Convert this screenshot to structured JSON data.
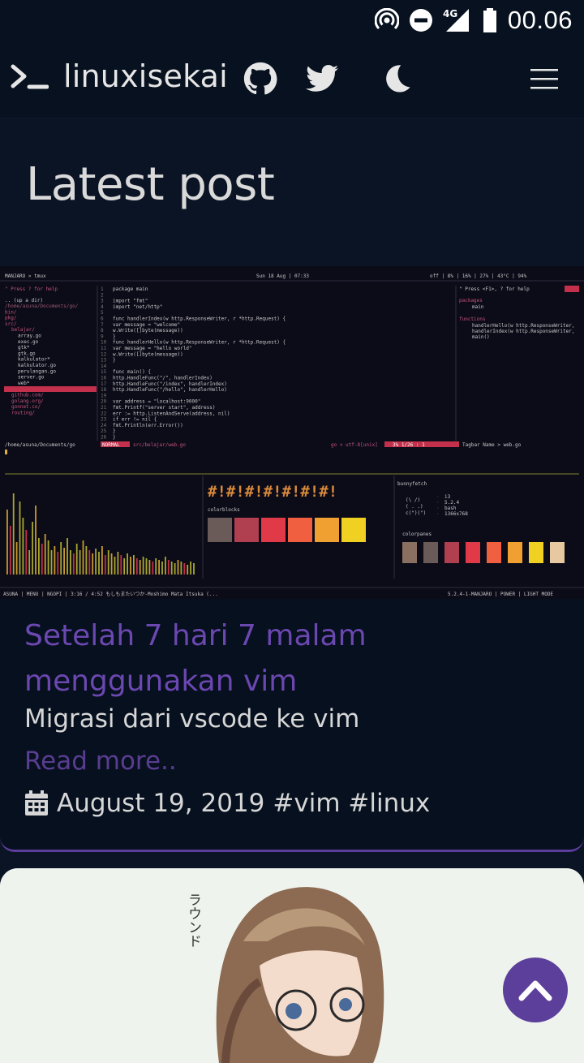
{
  "status_bar": {
    "time": "00.06",
    "network_label": "4G",
    "icons": [
      "hotspot-icon",
      "do-not-disturb-icon",
      "signal-4g-icon",
      "battery-icon"
    ]
  },
  "navbar": {
    "brand_prompt": ">_",
    "brand_title": "linuxisekai",
    "icons": [
      "github-icon",
      "twitter-icon",
      "moon-icon",
      "hamburger-menu-icon"
    ]
  },
  "section": {
    "title": "Latest post"
  },
  "posts": [
    {
      "title": "Setelah 7 hari 7 malam menggunakan vim",
      "description": "Migrasi dari vscode ke vim",
      "read_more": "Read more..",
      "date": "August 19, 2019",
      "tags": "#vim #linux"
    },
    {
      "image_text": "ラウンド"
    }
  ],
  "screenshot": {
    "top_left": "MANJARO »  tmux",
    "top_center": "Sun 18 Aug | 07:33",
    "top_right": "off | 8% | 16% | 27% | 43°C | 94%",
    "help_text": "\" Press ? for help",
    "cwd": "/home/asuna/Documents/go/",
    "tree": [
      ".. (up a dir)",
      "bin/",
      "pkg/",
      "src/",
      "belajar/",
      "array.go",
      "exec.go",
      "gtk*",
      "gtk.go",
      "kalkulator*",
      "kalkulator.go",
      "perulangan.go",
      "server.go",
      "web*",
      "web.go",
      "github.com/",
      "golang.org/",
      "gonnet.co/",
      "routing/"
    ],
    "code": [
      "package main",
      "",
      "import \"fmt\"",
      "import \"net/http\"",
      "",
      "func handlerIndex(w http.ResponseWriter, r *http.Request) {",
      "    var message = \"welcome\"",
      "    w.Write([]byte(message))",
      "}",
      "func handlerHello(w http.ResponseWriter, r *http.Request) {",
      "    var message = \"hello world\"",
      "    w.Write([]byte(message))",
      "}",
      "",
      "func main() {",
      "    http.HandleFunc(\"/\", handlerIndex)",
      "    http.HandleFunc(\"/index\", handlerIndex)",
      "    http.HandleFunc(\"/hello\", handlerHello)",
      "",
      "    var address = \"localhost:9000\"",
      "    fmt.Printf(\"server start\", address)",
      "    err := http.ListenAndServe(address, nil)",
      "    if err != nil {",
      "        fmt.Println(err.Error())",
      "    }",
      "}"
    ],
    "tagbar_help": "\" Press <F1>, ? for help",
    "tagbar_items": [
      "packages",
      "main",
      "functions",
      "handlerHello(w http.ResponseWriter,",
      "handlerIndex(w http.ResponseWriter,",
      "main()"
    ],
    "mode": "NORMAL",
    "file": "src/belajar/web.go",
    "fileinfo": "go < utf-8[unix]",
    "position": "3%  1/26 : 1",
    "tagbar_status": "Tagbar  Name > web.go",
    "bottom_path": "/home/asuna/Documents/go",
    "colorblocks_label": "colorblocks",
    "colorpanes_label": "colorpanes",
    "bunnyfetch_label": "bunnyfetch",
    "bunnyfetch_info": [
      "i3",
      "5.2.4",
      "bash",
      "1366x768"
    ],
    "bottom_bar": "ASUNA | MENU | NGOPI | 3:16 / 4:52  もしもまたいつか-Moshimo Mata Itsuka (...",
    "bottom_bar_right": "5.2.4-1-MANJARO | POWER | LIGHT MODE"
  }
}
